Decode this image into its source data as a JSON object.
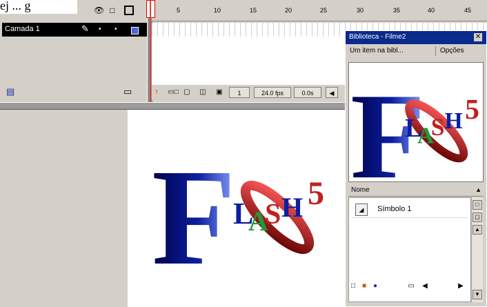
{
  "caption": {
    "text": "ej ... g"
  },
  "timeline": {
    "layer_name": "Camada 1",
    "ruler_ticks": [
      "5",
      "10",
      "15",
      "20",
      "25",
      "30",
      "35",
      "40",
      "45"
    ],
    "current_frame": "1",
    "frame_rate": "24.0 fps",
    "elapsed_time": "0.0s"
  },
  "library": {
    "title": "Biblioteca - Filme2",
    "item_count": "Um item na bibl...",
    "options_label": "Opções",
    "column_header": "Nome",
    "items": [
      {
        "label": "Símbolo 1",
        "type_icon": "graphic-symbol-icon"
      }
    ]
  },
  "logo": {
    "big_letter": "F",
    "letters": [
      "L",
      "A",
      "S",
      "H"
    ],
    "version": "5",
    "colors": {
      "blue": "#0b1fa0",
      "green": "#1f9a3a",
      "red": "#c41f1f",
      "dark_red": "#7a0f0f"
    }
  },
  "colors": {
    "chrome": "#d4d0c8",
    "title_bar": "#0a2a8c",
    "playhead": "#e43a3a",
    "layer_color": "#4b62d9"
  }
}
